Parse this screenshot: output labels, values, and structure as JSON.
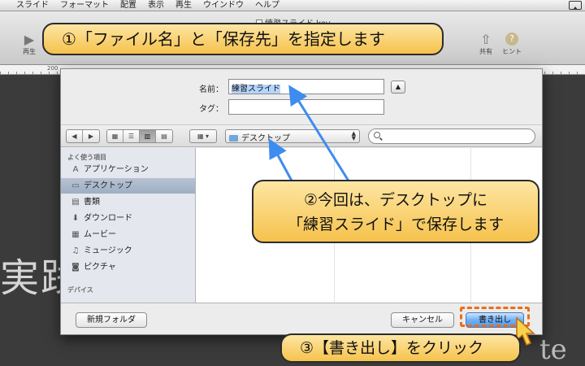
{
  "menubar": {
    "items": [
      "スライド",
      "フォーマット",
      "配置",
      "表示",
      "再生",
      "ウインドウ",
      "ヘルプ"
    ]
  },
  "toolbar": {
    "doc_title": "練習スライド.key",
    "play_label": "再生",
    "share_label": "共有",
    "hint_label": "ヒント"
  },
  "ruler": {
    "label": "200"
  },
  "canvas": {
    "text_left": "実践",
    "text_right": "te"
  },
  "dialog": {
    "name_label": "名前：",
    "name_value": "練習スライド",
    "tags_label": "タグ：",
    "tags_value": "",
    "location": "デスクトップ",
    "search_placeholder": "",
    "sidebar": {
      "favorites_header": "よく使う項目",
      "favorites": [
        {
          "label": "アプリケーション",
          "icon": "applications-icon"
        },
        {
          "label": "デスクトップ",
          "icon": "desktop-icon",
          "selected": true
        },
        {
          "label": "書類",
          "icon": "documents-icon"
        },
        {
          "label": "ダウンロード",
          "icon": "download-icon"
        },
        {
          "label": "ムービー",
          "icon": "movies-icon"
        },
        {
          "label": "ミュージック",
          "icon": "music-icon"
        },
        {
          "label": "ピクチャ",
          "icon": "pictures-icon"
        }
      ],
      "devices_header": "デバイス"
    },
    "new_folder_label": "新規フォルダ",
    "cancel_label": "キャンセル",
    "export_label": "書き出し"
  },
  "callouts": {
    "step1": "①「ファイル名」と「保存先」を指定します",
    "step2_line1": "②今回は、デスクトップに",
    "step2_line2": "「練習スライド」で保存します",
    "step3": "③【書き出し】をクリック"
  },
  "colors": {
    "callout_fill": "#f6c24c",
    "arrow": "#3d8cf0",
    "highlight": "#ec6d16",
    "sidebar_selected": "#a9b8cc"
  }
}
